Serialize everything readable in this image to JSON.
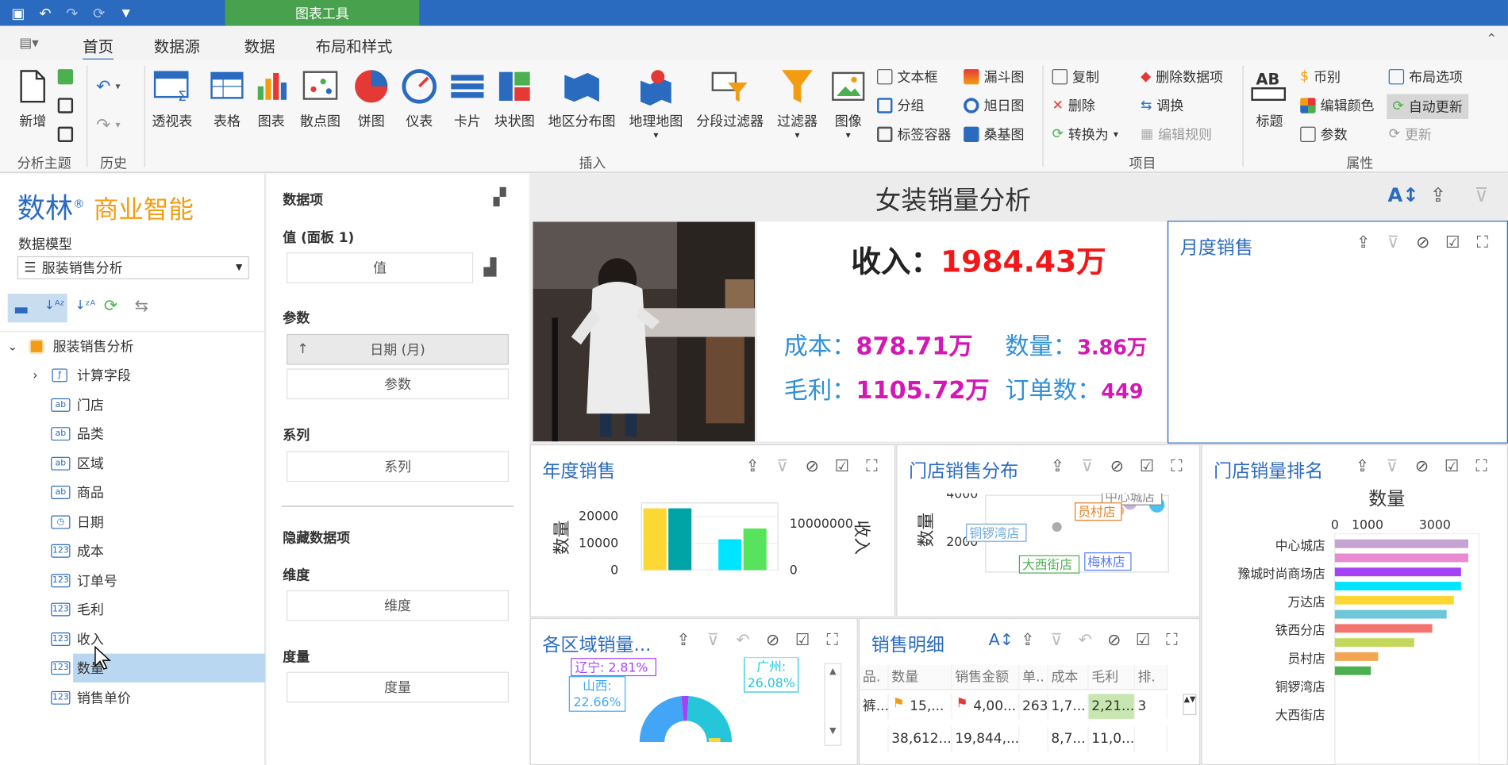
{
  "titlebar": {
    "context_tab": "图表工具"
  },
  "ribbon_tabs": [
    "首页",
    "数据源",
    "数据",
    "布局和样式"
  ],
  "ribbon": {
    "analysis": {
      "new": "新增",
      "group": "分析主题"
    },
    "history": {
      "group": "历史"
    },
    "insert": {
      "pivot": "透视表",
      "grid": "表格",
      "chart": "图表",
      "scatter": "散点图",
      "pie": "饼图",
      "gauge": "仪表",
      "card": "卡片",
      "treemap": "块状图",
      "geo_area": "地区分布图",
      "geo_point": "地理地图",
      "range_filter": "分段过滤器",
      "filter": "过滤器",
      "image": "图像",
      "group": "插入"
    },
    "small_insert": [
      "文本框",
      "分组",
      "标签容器",
      "漏斗图",
      "旭日图",
      "桑基图"
    ],
    "item": {
      "copy": "复制",
      "delete": "删除",
      "convert": "转换为",
      "delete_data": "删除数据项",
      "swap": "调换",
      "edit_rules": "编辑规则",
      "group": "项目"
    },
    "props": {
      "title": "标题",
      "currency": "币别",
      "edit_colors": "编辑颜色",
      "params": "参数",
      "layout_options": "布局选项",
      "auto_update": "自动更新",
      "update": "更新",
      "group": "属性"
    }
  },
  "left": {
    "brand": "数林",
    "brand_reg": "®",
    "brand_sub": "商业智能",
    "model_label": "数据模型",
    "model_value": "服装销售分析",
    "root": "服装销售分析",
    "fields": [
      {
        "type": "f",
        "name": "计算字段"
      },
      {
        "type": "ab",
        "name": "门店"
      },
      {
        "type": "ab",
        "name": "品类"
      },
      {
        "type": "ab",
        "name": "区域"
      },
      {
        "type": "ab",
        "name": "商品"
      },
      {
        "type": "d",
        "name": "日期"
      },
      {
        "type": "123",
        "name": "成本"
      },
      {
        "type": "123",
        "name": "订单号"
      },
      {
        "type": "123",
        "name": "毛利"
      },
      {
        "type": "123",
        "name": "收入"
      },
      {
        "type": "123",
        "name": "数量"
      },
      {
        "type": "123",
        "name": "销售单价"
      }
    ]
  },
  "mid": {
    "data_items": "数据项",
    "values_label": "值 (面板 1)",
    "values_box": "值",
    "params_label": "参数",
    "param_date": "日期 (月)",
    "param_box": "参数",
    "series_label": "系列",
    "series_box": "系列",
    "hidden_label": "隐藏数据项",
    "dim_label": "维度",
    "dim_box": "维度",
    "measure_label": "度量",
    "measure_box": "度量"
  },
  "dashboard": {
    "title": "女装销量分析",
    "kpi": {
      "revenue_label": "收入：",
      "revenue_value": "1984.43万",
      "cost_label": "成本：",
      "cost_value": "878.71万",
      "qty_label": "数量：",
      "qty_value": "3.86万",
      "profit_label": "毛利：",
      "profit_value": "1105.72万",
      "orders_label": "订单数：",
      "orders_value": "449"
    },
    "monthly_title": "月度销售",
    "annual_title": "年度销售",
    "store_dist_title": "门店销售分布",
    "store_rank_title": "门店销量排名",
    "region_title": "各区域销量...",
    "detail_title": "销售明细"
  },
  "chart_data": [
    {
      "type": "bar",
      "title": "年度销售",
      "ylabel": "数量",
      "y2label": "收入",
      "y_ticks": [
        "0",
        "10000",
        "20000"
      ],
      "y2_ticks": [
        "0",
        "10000000"
      ],
      "series": [
        {
          "values": [
            23000,
            11500
          ]
        },
        {
          "values": [
            23000,
            15500
          ]
        }
      ],
      "colors": [
        "#fdd835",
        "#00a4a6",
        "#00e5ff",
        "#57e35b"
      ]
    },
    {
      "type": "scatter",
      "title": "门店销售分布",
      "ylabel": "数量",
      "y_ticks": [
        "2000",
        "4000"
      ],
      "labels": [
        "中心城店",
        "员村店",
        "铜锣湾店",
        "大西街店",
        "梅林店"
      ]
    },
    {
      "type": "bar",
      "title": "门店销量排名",
      "orientation": "horizontal",
      "xlabel": "数量",
      "x_ticks": [
        "0",
        "1000",
        "3000"
      ],
      "categories": [
        "中心城店",
        "豫城时尚商场店",
        "万达店",
        "铁西分店",
        "员村店",
        "铜锣湾店",
        "大西街店"
      ],
      "values": [
        3700,
        3700,
        3500,
        3500,
        3300,
        3100,
        2700,
        2200,
        1200,
        1000
      ],
      "colors": [
        "#c5a3d2",
        "#e88bd0",
        "#a542f5",
        "#00e5ff",
        "#fdd835",
        "#6ec6d8",
        "#f4736d",
        "#c4d85b",
        "#f2a651",
        "#4caf50",
        "#8bafd5",
        "#8a8af2",
        "#6ed3a0"
      ]
    },
    {
      "type": "pie",
      "title": "各区域销量",
      "labels": [
        "辽宁: 2.81%",
        "山西: 22.66%",
        "广州: 26.08%"
      ]
    }
  ],
  "detail_table": {
    "headers": [
      "品.",
      "数量",
      "销售金额",
      "单..",
      "成本",
      "毛利",
      "排."
    ],
    "row": [
      "裤...",
      "15,...",
      "4,00...",
      "263",
      "1,7...",
      "2,21...",
      "3"
    ],
    "totals": [
      "",
      "38,612...",
      "19,844,...",
      "",
      "8,7...",
      "11,0...",
      ""
    ]
  }
}
